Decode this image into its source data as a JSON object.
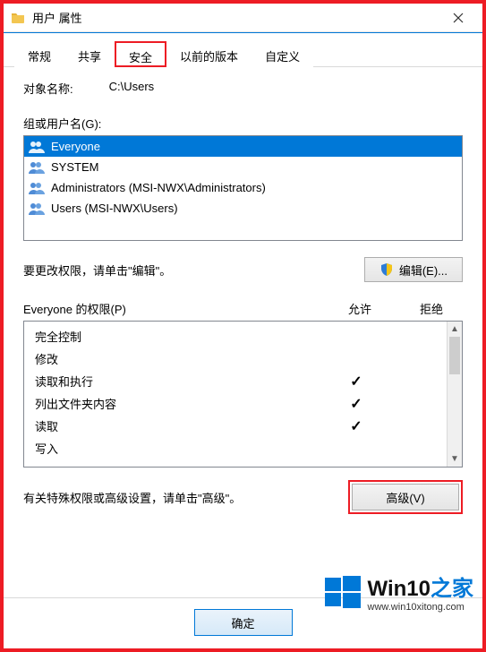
{
  "titlebar": {
    "title": "用户 属性"
  },
  "tabs": {
    "items": [
      {
        "label": "常规"
      },
      {
        "label": "共享"
      },
      {
        "label": "安全"
      },
      {
        "label": "以前的版本"
      },
      {
        "label": "自定义"
      }
    ],
    "active_index": 2
  },
  "object_name": {
    "label": "对象名称:",
    "value": "C:\\Users"
  },
  "groups": {
    "label": "组或用户名(G):",
    "items": [
      {
        "text": "Everyone",
        "selected": true
      },
      {
        "text": "SYSTEM",
        "selected": false
      },
      {
        "text": "Administrators (MSI-NWX\\Administrators)",
        "selected": false
      },
      {
        "text": "Users (MSI-NWX\\Users)",
        "selected": false
      }
    ]
  },
  "edit": {
    "hint": "要更改权限，请单击\"编辑\"。",
    "button": "编辑(E)..."
  },
  "permissions": {
    "title": "Everyone 的权限(P)",
    "allow_label": "允许",
    "deny_label": "拒绝",
    "rows": [
      {
        "name": "完全控制",
        "allow": false,
        "deny": false
      },
      {
        "name": "修改",
        "allow": false,
        "deny": false
      },
      {
        "name": "读取和执行",
        "allow": true,
        "deny": false
      },
      {
        "name": "列出文件夹内容",
        "allow": true,
        "deny": false
      },
      {
        "name": "读取",
        "allow": true,
        "deny": false
      },
      {
        "name": "写入",
        "allow": false,
        "deny": false
      }
    ]
  },
  "advanced": {
    "hint": "有关特殊权限或高级设置，请单击\"高级\"。",
    "button": "高级(V)"
  },
  "buttons": {
    "ok": "确定"
  },
  "watermark": {
    "brand": "Win10",
    "suffix": "之家",
    "url": "www.win10xitong.com"
  },
  "colors": {
    "accent": "#0078d7",
    "highlight_box": "#ed1c24"
  }
}
